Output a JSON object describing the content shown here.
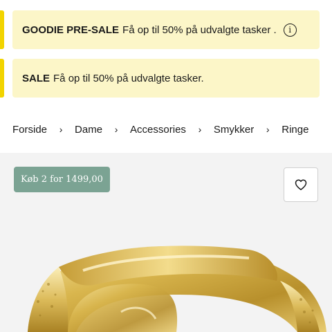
{
  "banners": [
    {
      "strong": "GOODIE PRE-SALE",
      "text": "Få op til 50% på udvalgte tasker .",
      "icon": "info-icon"
    },
    {
      "strong": "SALE",
      "text": "Få op til 50% på udvalgte tasker."
    }
  ],
  "breadcrumb": [
    "Forside",
    "Dame",
    "Accessories",
    "Smykker",
    "Ringe"
  ],
  "breadcrumb_separator": "›",
  "product": {
    "promo_badge": "Køb 2 for 1499,00",
    "wishlist_icon": "heart-icon",
    "image_alt": "gold-signet-ring"
  },
  "colors": {
    "banner_bg": "#fcf6c8",
    "banner_accent": "#f2d400",
    "badge_bg": "#7ba393",
    "product_bg": "#f3f3f3"
  }
}
